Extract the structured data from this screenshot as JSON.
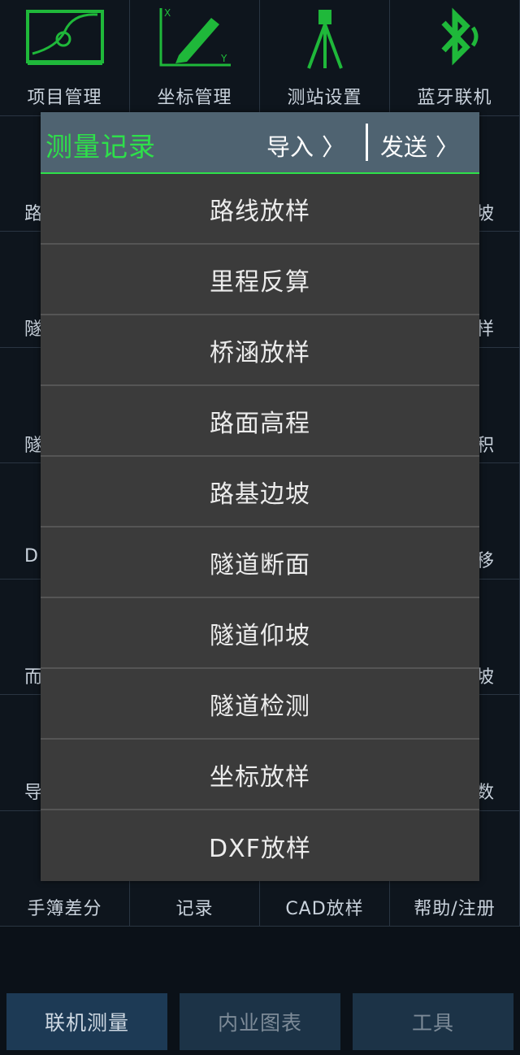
{
  "grid": {
    "cells": [
      {
        "label": "项目管理",
        "align": "center"
      },
      {
        "label": "坐标管理",
        "align": "center"
      },
      {
        "label": "测站设置",
        "align": "center"
      },
      {
        "label": "蓝牙联机",
        "align": "center"
      },
      {
        "label": "路",
        "align": "left"
      },
      {
        "label": "",
        "align": "center"
      },
      {
        "label": "",
        "align": "center"
      },
      {
        "label": "坡",
        "align": "right"
      },
      {
        "label": "隧",
        "align": "left"
      },
      {
        "label": "",
        "align": "center"
      },
      {
        "label": "",
        "align": "center"
      },
      {
        "label": "样",
        "align": "right"
      },
      {
        "label": "隧",
        "align": "left"
      },
      {
        "label": "",
        "align": "center"
      },
      {
        "label": "",
        "align": "center"
      },
      {
        "label": "积",
        "align": "right"
      },
      {
        "label": "D",
        "align": "left"
      },
      {
        "label": "",
        "align": "center"
      },
      {
        "label": "",
        "align": "center"
      },
      {
        "label": "移",
        "align": "right"
      },
      {
        "label": "而",
        "align": "left"
      },
      {
        "label": "",
        "align": "center"
      },
      {
        "label": "",
        "align": "center"
      },
      {
        "label": "坡",
        "align": "right"
      },
      {
        "label": "导",
        "align": "left"
      },
      {
        "label": "",
        "align": "center"
      },
      {
        "label": "",
        "align": "center"
      },
      {
        "label": "数",
        "align": "right"
      },
      {
        "label": "手簿差分",
        "align": "center"
      },
      {
        "label": "记录",
        "align": "center"
      },
      {
        "label": "CAD放样",
        "align": "center"
      },
      {
        "label": "帮助/注册",
        "align": "center"
      }
    ]
  },
  "bottom_bar": {
    "buttons": [
      "联机测量",
      "内业图表",
      "工具"
    ]
  },
  "dialog": {
    "title": "测量记录",
    "import_label": "导入",
    "send_label": "发送",
    "chevron": "〉",
    "items": [
      "路线放样",
      "里程反算",
      "桥涵放样",
      "路面高程",
      "路基边坡",
      "隧道断面",
      "隧道仰坡",
      "隧道检测",
      "坐标放样",
      "DXF放样"
    ]
  },
  "colors": {
    "accent": "#2ee04a",
    "header_bg": "#4f6371",
    "dialog_bg": "#3b3b3b",
    "icon_green": "#1fb83a"
  }
}
